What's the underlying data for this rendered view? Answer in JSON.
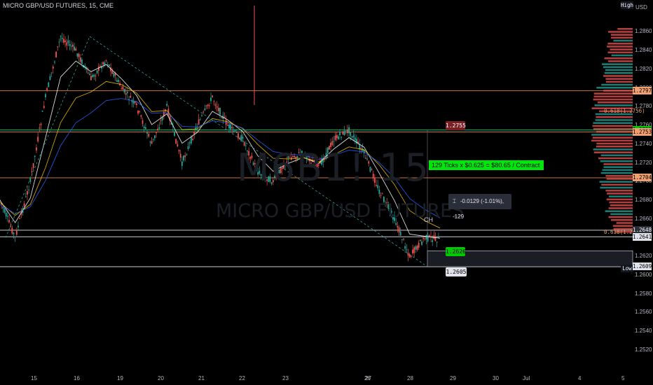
{
  "header": {
    "symbol_title": "MICRO GBP/USD FUTURES, 15, CME"
  },
  "watermark": {
    "ticker": "M6B1! 15",
    "name": "MICRO GBP/USD FUTURES"
  },
  "annotations": {
    "ticks_text": "129 Ticks x $0.625 = $80.65 / Contract",
    "measure_text": "-0.0129 (-1.01%), -129",
    "ch_label": "CH",
    "fib_upper": "0.618(1.2756)",
    "fib_lower": "0.618(1.2641)",
    "price_box_red": "1.2755",
    "price_box_green": "1.2626",
    "price_box_white": "1.2605"
  },
  "axis": {
    "currency": "USD",
    "high_label": "High",
    "low_label": "Low",
    "price_ticks": [
      "1.2860",
      "1.2840",
      "1.2820",
      "1.2800",
      "1.2780",
      "1.2760",
      "1.2740",
      "1.2720",
      "1.2700",
      "1.2680",
      "1.2660",
      "1.2640",
      "1.2620",
      "1.2600",
      "1.2580",
      "1.2560",
      "1.2540",
      "1.2520"
    ],
    "date_ticks": [
      "15",
      "16",
      "19",
      "20",
      "21",
      "22",
      "23",
      "26",
      "27",
      "28",
      "29",
      "30",
      "Jul",
      "4",
      "5"
    ]
  },
  "price_tags": [
    {
      "value": "1.2797",
      "bg": "#f0a070",
      "fg": "#000000"
    },
    {
      "value": "1.2755",
      "bg": "#00c800",
      "fg": "#000000"
    },
    {
      "value": "1.2753",
      "bg": "#f0a070",
      "fg": "#000000"
    },
    {
      "value": "1.2704",
      "bg": "#f0a070",
      "fg": "#000000"
    },
    {
      "value": "1.2648",
      "bg": "#2a2e39",
      "fg": "#ffffff"
    },
    {
      "value": "1.2641",
      "bg": "#e0e3eb",
      "fg": "#000000"
    },
    {
      "value": "1.2609",
      "bg": "#e0e3eb",
      "fg": "#000000"
    }
  ],
  "colors": {
    "background": "#000000",
    "green_line": "#00e676",
    "orange_line": "#e08040",
    "candle_up": "#26a69a",
    "candle_down": "#ef5350",
    "ma_fast": "#ffffff",
    "ma_mid": "#f0c000",
    "ma_slow": "#2962ff"
  },
  "chart_data": {
    "type": "candlestick",
    "title": "MICRO GBP/USD FUTURES, 15, CME",
    "ylim": [
      1.2505,
      1.2885
    ],
    "x_axis_dates": [
      "15",
      "16",
      "19",
      "20",
      "21",
      "22",
      "23",
      "26",
      "27",
      "28",
      "29",
      "30",
      "Jul",
      "4",
      "5"
    ],
    "price_path": [
      [
        "15",
        1.268
      ],
      [
        "15",
        1.264
      ],
      [
        "16",
        1.27
      ],
      [
        "16",
        1.279
      ],
      [
        "16",
        1.2855
      ],
      [
        "16",
        1.284
      ],
      [
        "19",
        1.281
      ],
      [
        "19",
        1.283
      ],
      [
        "20",
        1.28
      ],
      [
        "20",
        1.278
      ],
      [
        "20",
        1.274
      ],
      [
        "21",
        1.278
      ],
      [
        "21",
        1.272
      ],
      [
        "21",
        1.276
      ],
      [
        "22",
        1.279
      ],
      [
        "22",
        1.276
      ],
      [
        "22",
        1.2745
      ],
      [
        "23",
        1.271
      ],
      [
        "23",
        1.27
      ],
      [
        "23",
        1.2725
      ],
      [
        "26",
        1.273
      ],
      [
        "26",
        1.2715
      ],
      [
        "27",
        1.2745
      ],
      [
        "27",
        1.2755
      ],
      [
        "28",
        1.273
      ],
      [
        "28",
        1.269
      ],
      [
        "28",
        1.266
      ],
      [
        "28",
        1.262
      ],
      [
        "28",
        1.264
      ],
      [
        "28",
        1.2638
      ]
    ],
    "horizontal_levels": [
      {
        "price": 1.2797,
        "color": "#e08040"
      },
      {
        "price": 1.2755,
        "color": "#00e676"
      },
      {
        "price": 1.2753,
        "color": "#e08040"
      },
      {
        "price": 1.2704,
        "color": "#e08040"
      },
      {
        "price": 1.2648,
        "color": "#e0e3eb"
      },
      {
        "price": 1.2641,
        "color": "#e0e3eb"
      },
      {
        "price": 1.2609,
        "color": "#e0e3eb"
      }
    ],
    "fib_levels": [
      {
        "ratio": 0.618,
        "price": 1.2756
      },
      {
        "ratio": 0.618,
        "price": 1.2641
      }
    ],
    "measurement": {
      "change": -0.0129,
      "change_pct": -1.01,
      "ticks": -129,
      "from": 1.2755,
      "to": 1.2626
    },
    "session_high_label": "High",
    "session_low": 1.2609
  }
}
